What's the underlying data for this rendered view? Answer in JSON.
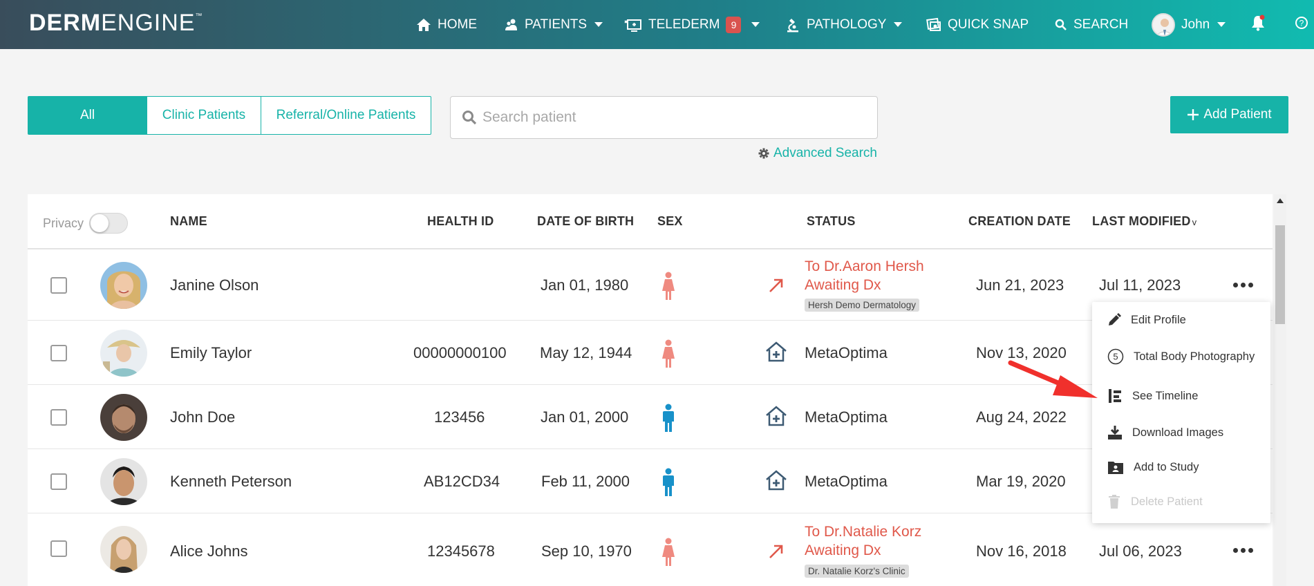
{
  "app": {
    "logo_bold": "DERM",
    "logo_light": "ENGINE",
    "logo_tm": "™"
  },
  "nav": {
    "home": "HOME",
    "patients": "PATIENTS",
    "telederm": "TELEDERM",
    "telederm_badge": "9",
    "pathology": "PATHOLOGY",
    "quick_snap": "QUICK SNAP",
    "search": "SEARCH",
    "user": "John"
  },
  "filters": {
    "all": "All",
    "clinic": "Clinic Patients",
    "referral": "Referral/Online Patients",
    "search_placeholder": "Search patient",
    "advanced_search": "Advanced Search",
    "add_patient": "Add Patient"
  },
  "table": {
    "privacy_label": "Privacy",
    "columns": {
      "name": "NAME",
      "health_id": "HEALTH ID",
      "dob": "DATE OF BIRTH",
      "sex": "SEX",
      "status": "STATUS",
      "creation": "CREATION DATE",
      "modified": "LAST MODIFIED",
      "sort_indicator": "v"
    },
    "rows": [
      {
        "name": "Janine Olson",
        "health_id": "",
        "dob": "Jan 01, 1980",
        "sex": "female",
        "status_type": "referral",
        "status_line1": "To Dr.Aaron Hersh",
        "status_line2": "Awaiting Dx",
        "clinic_tag": "Hersh Demo Dermatology",
        "creation": "Jun 21, 2023",
        "modified": "Jul 11, 2023"
      },
      {
        "name": "Emily Taylor",
        "health_id": "00000000100",
        "dob": "May 12, 1944",
        "sex": "female",
        "status_type": "clinic",
        "status": "MetaOptima",
        "creation": "Nov 13, 2020",
        "modified": ""
      },
      {
        "name": "John Doe",
        "health_id": "123456",
        "dob": "Jan 01, 2000",
        "sex": "male",
        "status_type": "clinic",
        "status": "MetaOptima",
        "creation": "Aug 24, 2022",
        "modified": ""
      },
      {
        "name": "Kenneth Peterson",
        "health_id": "AB12CD34",
        "dob": "Feb 11, 2000",
        "sex": "male",
        "status_type": "clinic",
        "status": "MetaOptima",
        "creation": "Mar 19, 2020",
        "modified": ""
      },
      {
        "name": "Alice Johns",
        "health_id": "12345678",
        "dob": "Sep 10, 1970",
        "sex": "female",
        "status_type": "referral",
        "status_line1": "To Dr.Natalie Korz",
        "status_line2": "Awaiting Dx",
        "clinic_tag": "Dr. Natalie Korz's Clinic",
        "creation": "Nov 16, 2018",
        "modified": "Jul 06, 2023"
      }
    ]
  },
  "menu": {
    "edit_profile": "Edit Profile",
    "tbp_count": "5",
    "total_body_photography": "Total Body Photography",
    "see_timeline": "See Timeline",
    "download_images": "Download Images",
    "add_to_study": "Add to Study",
    "delete_patient": "Delete Patient"
  },
  "colors": {
    "accent": "#17b3a8",
    "referral_red": "#e0584a",
    "female": "#ef8a80",
    "male": "#1891c9",
    "annotation_arrow": "#f0302c"
  }
}
